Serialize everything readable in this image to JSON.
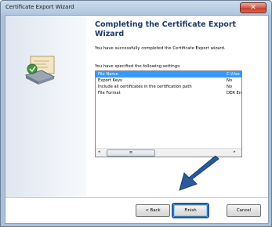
{
  "window": {
    "title": "Certificate Export Wizard",
    "close_glyph": "✕"
  },
  "content": {
    "heading": "Completing the Certificate Export Wizard",
    "success_text": "You have successfully completed the Certificate Export wizard.",
    "settings_label": "You have specified the following settings:"
  },
  "settings_list": [
    {
      "name": "File Name",
      "value": "C:\\Use"
    },
    {
      "name": "Export Keys",
      "value": "No"
    },
    {
      "name": "Include all certificates in the certification path",
      "value": "No"
    },
    {
      "name": "File Format",
      "value": "DER En"
    }
  ],
  "scrollbar": {
    "left_arrow": "◂",
    "right_arrow": "▸",
    "thumb_grip": "≡"
  },
  "buttons": {
    "back": "< Back",
    "finish": "Finish",
    "cancel": "Cancel"
  },
  "colors": {
    "heading": "#1b3a6b",
    "selection": "#3399ff",
    "callout_arrow": "#2a5a9c"
  },
  "icons": [
    "certificate-icon",
    "close-icon",
    "arrow-pointer-icon"
  ]
}
